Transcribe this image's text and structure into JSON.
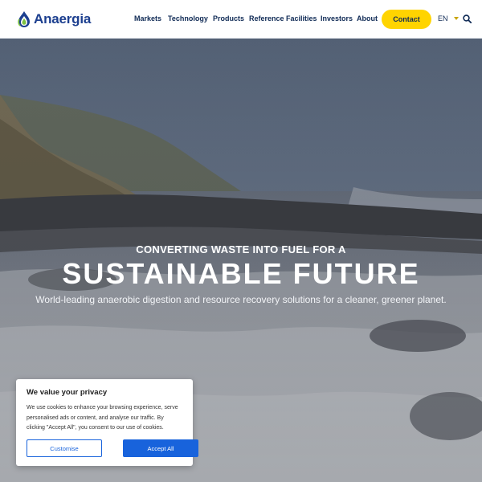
{
  "brand": {
    "name": "Anaergia",
    "color": "#1c3f8f"
  },
  "nav": {
    "items": [
      {
        "label": "Markets"
      },
      {
        "label": "Technology"
      },
      {
        "label": "Products"
      },
      {
        "label": "Reference Facilities"
      },
      {
        "label": "Investors"
      },
      {
        "label": "About"
      }
    ],
    "contact_label": "Contact",
    "contact_color": "#ffd400",
    "language": "EN",
    "search_icon": "search-icon"
  },
  "hero": {
    "eyebrow": "CONVERTING WASTE INTO FUEL FOR A",
    "title": "SUSTAINABLE FUTURE",
    "subtitle": "World-leading anaerobic digestion and resource recovery solutions for a cleaner, greener planet."
  },
  "cookie": {
    "title": "We value your privacy",
    "text": "We use cookies to enhance your browsing experience, serve personalised ads or content, and analyse our traffic. By clicking \"Accept All\", you consent to our use of cookies.",
    "customise_label": "Customise",
    "accept_label": "Accept All",
    "accent_color": "#1863dc"
  }
}
